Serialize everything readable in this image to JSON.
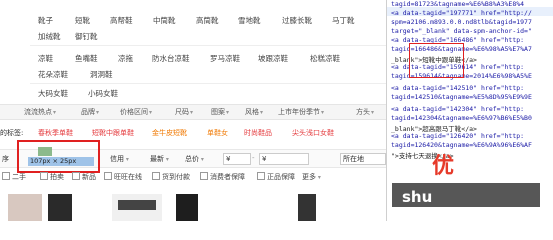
{
  "categories": {
    "row1": [
      "靴子",
      "短靴",
      "高帮鞋",
      "中筒靴",
      "高筒靴",
      "雪地靴",
      "过膝长靴",
      "马丁靴"
    ],
    "row2": [
      "加绒靴",
      "御钉靴"
    ],
    "row3": [
      "凉鞋",
      "鱼嘴鞋",
      "凉拖",
      "防水台凉鞋",
      "罗马凉鞋",
      "坡跟凉鞋",
      "松糕凉鞋"
    ],
    "row4": [
      "花朵凉鞋",
      "洞洞鞋"
    ],
    "row5": [
      "大码女鞋",
      "小码女鞋"
    ]
  },
  "filterbar": {
    "items": [
      "流流热点",
      "品牌",
      "价格区间",
      "尺码",
      "图案",
      "风格",
      "上市年份季节",
      "方头"
    ]
  },
  "tags": {
    "prefix": "的标签:",
    "items": [
      "春秋季单鞋",
      "短靴中跟单鞋",
      "金牛皮短靴",
      "单鞋女",
      "时尚鞋品",
      "尖头浅口女鞋"
    ]
  },
  "sortbar": {
    "sort_label": "序",
    "dim_label": "107px × 25px",
    "credit": "信用",
    "newest": "最新",
    "total_price": "总价",
    "price_from": "¥",
    "price_to": "¥",
    "location": "所在地"
  },
  "checks": [
    "二手",
    "拍卖",
    "新品",
    "旺旺在线",
    "货到付款",
    "消费者保障",
    "正品保障",
    "更多"
  ],
  "devtools": {
    "lines": [
      {
        "t": "tagid=81723&tagname=%E6%B8%A3%E8%4"
      },
      {
        "t": "<a data-tagid=\"197771\" href=\"http://"
      },
      {
        "t": "spm=a2106.m893.0.0.nd8tlb&tagid=1977"
      },
      {
        "t": "target=\"_blank\" data-spm-anchor-id=\""
      },
      {
        "t": "<a data-tagid=\"166486\" href=\"http:"
      },
      {
        "t": "tagid=166486&tagname=%E6%98%A5%E7%A7"
      },
      {
        "t": "_blank\">短靴中跟单鞋</a>"
      },
      {
        "t": "<a data-tagid=\"159614\" href=\"http:"
      },
      {
        "t": "tagid=159614&tagname=2014%E6%98%A5%E"
      },
      {
        "t": "<a data-tagid=\"142510\" href=\"http:"
      },
      {
        "t": "tagid=142510&tagname=%E5%8D%95%E9%9E"
      },
      {
        "t": "<a data-tagid=\"142304\" href=\"http:"
      },
      {
        "t": "tagid=142304&tagname=%E6%97%B6%E5%B0"
      },
      {
        "t": "_blank\">超高跟马丁靴</a>"
      },
      {
        "t": "<a data-tagid=\"126420\" href=\"http:"
      },
      {
        "t": "tagid=126420&tagname=%E6%9A%96%E6%AF"
      },
      {
        "t": "\">支持七天退换</a>"
      }
    ]
  },
  "watermark": {
    "brand": "shu",
    "cn": "优"
  }
}
